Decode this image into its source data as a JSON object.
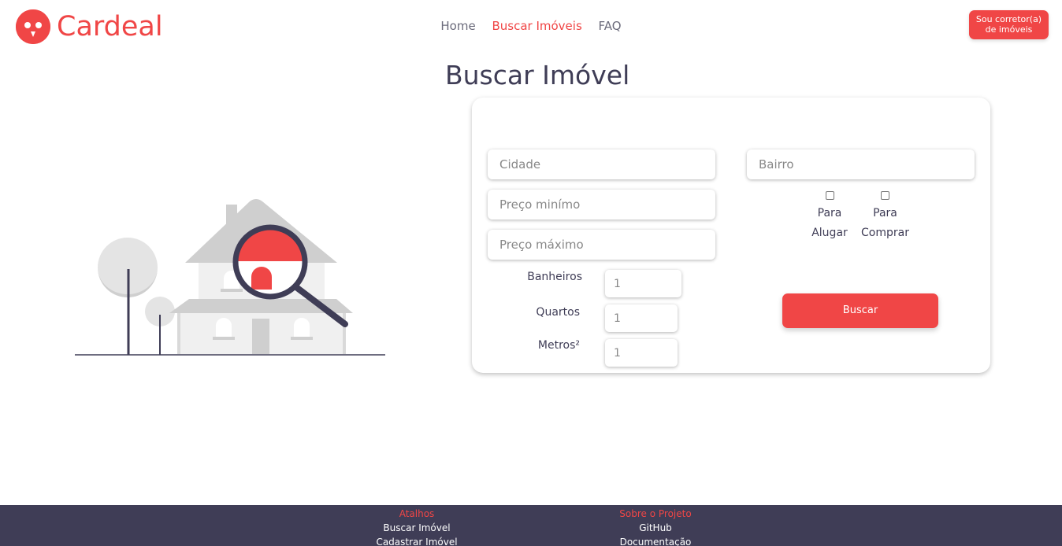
{
  "brand": {
    "name": "Cardeal",
    "color": "#f04646",
    "logo_icon": "bird-face-icon"
  },
  "nav": {
    "items": [
      {
        "label": "Home",
        "active": false
      },
      {
        "label": "Buscar Imóveis",
        "active": true
      },
      {
        "label": "FAQ",
        "active": false
      }
    ]
  },
  "cta": {
    "line1": "Sou corretor(a)",
    "line2": "de imóveis"
  },
  "page": {
    "title": "Buscar Imóvel"
  },
  "form": {
    "cidade_placeholder": "Cidade",
    "bairro_placeholder": "Bairro",
    "preco_min_placeholder": "Preço minímo",
    "preco_max_placeholder": "Preço máximo",
    "banheiros": {
      "label": "Banheiros",
      "value": "1"
    },
    "quartos": {
      "label": "Quartos",
      "value": "1"
    },
    "metros": {
      "label": "Metros²",
      "value": "1"
    },
    "alugar": {
      "line1": "Para",
      "line2": "Alugar",
      "checked": false
    },
    "comprar": {
      "line1": "Para",
      "line2": "Comprar",
      "checked": false
    },
    "submit_label": "Buscar"
  },
  "footer": {
    "col1": {
      "heading": "Atalhos",
      "links": [
        "Buscar Imóvel",
        "Cadastrar Imóvel"
      ]
    },
    "col2": {
      "heading": "Sobre o Projeto",
      "links": [
        "GitHub",
        "Documentação"
      ]
    }
  },
  "colors": {
    "accent": "#f04646",
    "dark": "#3f3d56"
  }
}
